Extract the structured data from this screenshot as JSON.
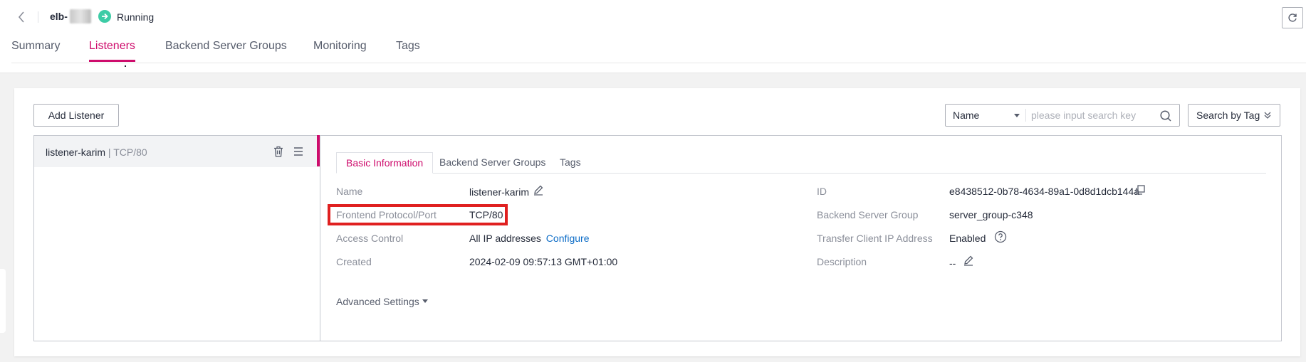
{
  "header": {
    "elb_name": "elb-",
    "status": "Running",
    "status_color": "#3dcca6"
  },
  "tabs": [
    {
      "label": "Summary",
      "active": false
    },
    {
      "label": "Listeners",
      "active": true
    },
    {
      "label": "Backend Server Groups",
      "active": false
    },
    {
      "label": "Monitoring",
      "active": false
    },
    {
      "label": "Tags",
      "active": false
    }
  ],
  "toolbar": {
    "add_label": "Add Listener",
    "search_field": "Name",
    "search_placeholder": "please input search key",
    "search_by_tag": "Search by Tag"
  },
  "listeners": [
    {
      "name": "listener-karim",
      "separator": " | ",
      "protocol": "TCP/80"
    }
  ],
  "detail": {
    "tabs": [
      {
        "label": "Basic Information",
        "active": true
      },
      {
        "label": "Backend Server Groups",
        "active": false
      },
      {
        "label": "Tags",
        "active": false
      }
    ],
    "left": {
      "name_label": "Name",
      "name_value": "listener-karim",
      "port_label": "Frontend Protocol/Port",
      "port_value": "TCP/80",
      "access_label": "Access Control",
      "access_value": "All IP addresses",
      "access_link": "Configure",
      "created_label": "Created",
      "created_value": "2024-02-09 09:57:13 GMT+01:00"
    },
    "right": {
      "id_label": "ID",
      "id_value": "e8438512-0b78-4634-89a1-0d8d1dcb144a",
      "group_label": "Backend Server Group",
      "group_value": "server_group-c348",
      "transfer_label": "Transfer Client IP Address",
      "transfer_value": "Enabled",
      "desc_label": "Description",
      "desc_value": "--"
    },
    "advanced_label": "Advanced Settings"
  },
  "colors": {
    "accent": "#ce0c6c",
    "link": "#0c6cc7",
    "highlight": "#e02020"
  }
}
